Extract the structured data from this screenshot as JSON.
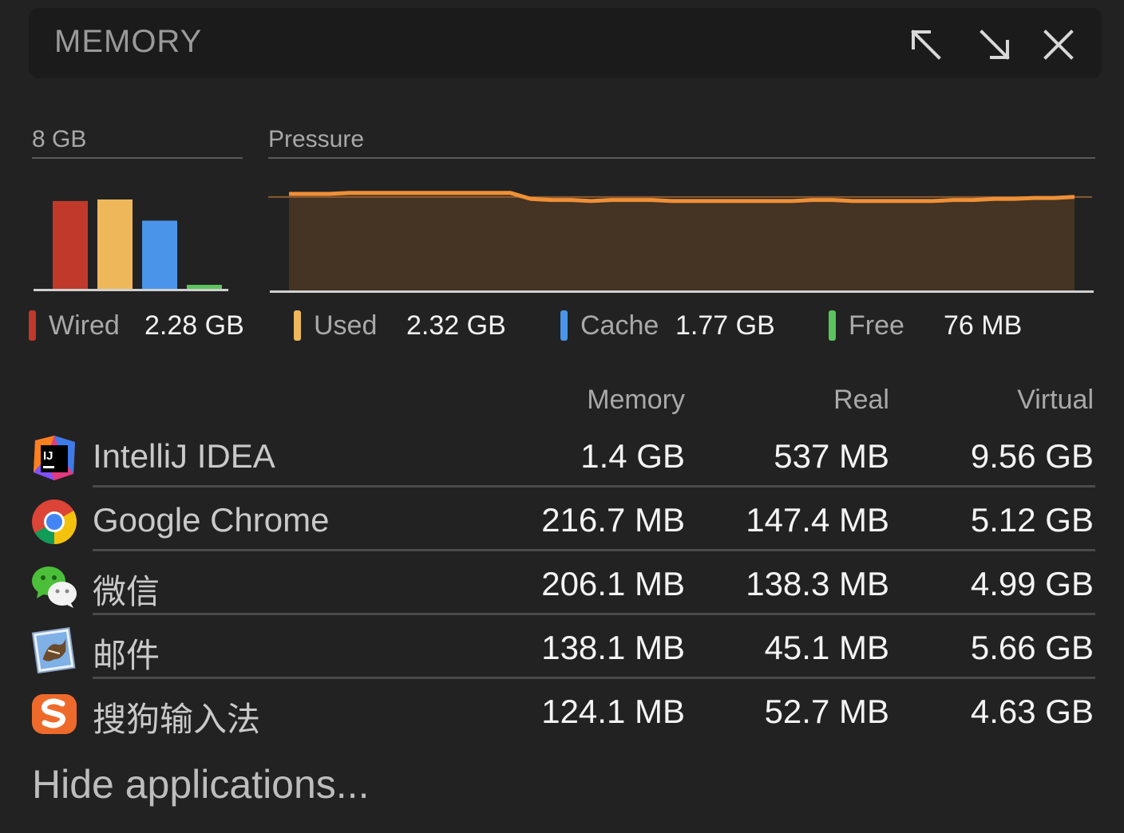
{
  "header": {
    "title": "MEMORY"
  },
  "sections": {
    "total_label": "8 GB",
    "pressure_label": "Pressure"
  },
  "memory_bars": {
    "max_gb": 2.32,
    "bars": [
      {
        "name": "Wired",
        "gb": 2.28,
        "color": "#c0392b"
      },
      {
        "name": "Used",
        "gb": 2.32,
        "color": "#eeb85a"
      },
      {
        "name": "Cache",
        "gb": 1.77,
        "color": "#4a95ea"
      },
      {
        "name": "Free",
        "gb": 0.076,
        "color": "#5cc45f"
      }
    ]
  },
  "pressure": {
    "line_color": "#ef9037",
    "fill_color": "#453323",
    "max": 100,
    "values": [
      96,
      96,
      96,
      97,
      97,
      97,
      97,
      97,
      97,
      97,
      97,
      97,
      91,
      90,
      90,
      89,
      90,
      90,
      90,
      89,
      89,
      89,
      89,
      89,
      89,
      89,
      90,
      90,
      89,
      89,
      89,
      89,
      89,
      90,
      90,
      91,
      91,
      92,
      92,
      93
    ]
  },
  "legend": [
    {
      "label": "Wired",
      "value": "2.28 GB",
      "color": "#c0392b"
    },
    {
      "label": "Used",
      "value": "2.32 GB",
      "color": "#eeb85a"
    },
    {
      "label": "Cache",
      "value": "1.77 GB",
      "color": "#4a95ea"
    },
    {
      "label": "Free",
      "value": "76 MB",
      "color": "#5cc45f"
    }
  ],
  "columns": {
    "memory": "Memory",
    "real": "Real",
    "virtual": "Virtual"
  },
  "apps": [
    {
      "name": "IntelliJ IDEA",
      "memory": "1.4 GB",
      "real": "537 MB",
      "virtual": "9.56 GB",
      "icon": "intellij-icon"
    },
    {
      "name": "Google Chrome",
      "memory": "216.7 MB",
      "real": "147.4 MB",
      "virtual": "5.12 GB",
      "icon": "chrome-icon"
    },
    {
      "name": "微信",
      "memory": "206.1 MB",
      "real": "138.3 MB",
      "virtual": "4.99 GB",
      "icon": "wechat-icon"
    },
    {
      "name": "邮件",
      "memory": "138.1 MB",
      "real": "45.1 MB",
      "virtual": "5.66 GB",
      "icon": "mail-icon"
    },
    {
      "name": "搜狗输入法",
      "memory": "124.1 MB",
      "real": "52.7 MB",
      "virtual": "4.63 GB",
      "icon": "sogou-icon"
    }
  ],
  "footer": {
    "hide_apps": "Hide applications..."
  }
}
